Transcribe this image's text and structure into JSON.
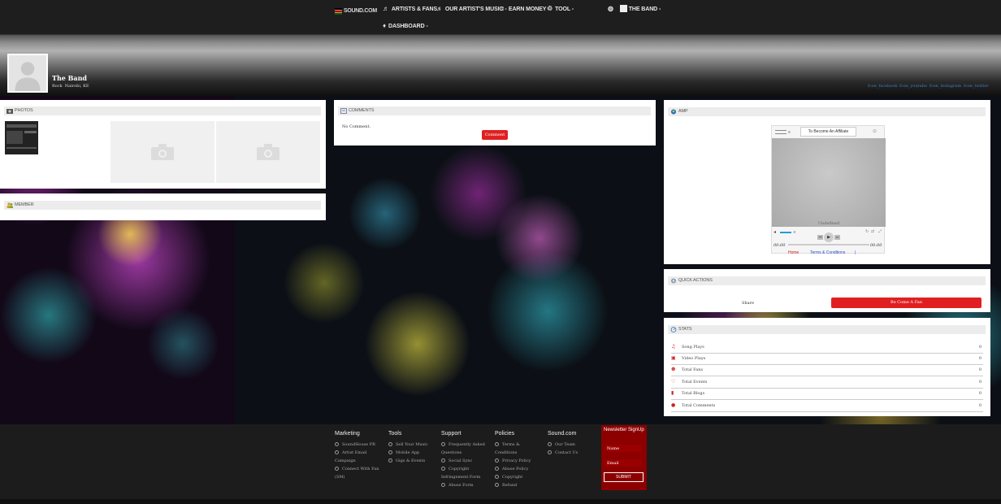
{
  "topnav": {
    "logo_text": "SOUND.COM",
    "items": [
      {
        "label": "ARTISTS & FANS",
        "icon": "music-note-icon"
      },
      {
        "label": "OUR ARTIST'S MUSIC",
        "icon": "music-note-icon"
      },
      {
        "label": "EARN MONEY",
        "icon": "music-note-icon"
      },
      {
        "label": "TOOL",
        "icon": "settings-icon"
      },
      {
        "label": "THE BAND",
        "icon": "globe-icon"
      },
      {
        "label": "DASHBOARD",
        "icon": "diamond-icon"
      }
    ],
    "caret": "-"
  },
  "profile": {
    "name": "The Band",
    "genre": "Rock",
    "location": "Nairobi, KE",
    "social_links": [
      "fcon_facebook",
      "fcon_youtube",
      "fcon_instagram",
      "fcon_twitter"
    ]
  },
  "photos": {
    "title": "PHOTOS"
  },
  "member": {
    "title": "MEMBER"
  },
  "comments": {
    "title": "COMMENTS",
    "empty_text": "No Comment.",
    "button_label": "Comment"
  },
  "amp": {
    "title": "AMP",
    "affiliate_label": "To Become An Affiliate",
    "track_status": "Undefined",
    "time_current": "00:00",
    "time_total": "00:00",
    "link_home": "Home",
    "link_terms": "Terms & Conditions",
    "link_sep": "|"
  },
  "quick_actions": {
    "title": "QUICK ACTIONS",
    "share_label": "Share",
    "fan_button": "Be Come A Fan"
  },
  "stats": {
    "title": "STATS",
    "rows": [
      {
        "label": "Song Plays",
        "value": "0",
        "icon": "music-note-icon"
      },
      {
        "label": "Video Plays",
        "value": "0",
        "icon": "video-icon"
      },
      {
        "label": "Total Fans",
        "value": "0",
        "icon": "users-icon"
      },
      {
        "label": "Total Events",
        "value": "0",
        "icon": "calendar-icon"
      },
      {
        "label": "Total Blogs",
        "value": "0",
        "icon": "bookmark-icon"
      },
      {
        "label": "Total Comments",
        "value": "0",
        "icon": "comments-icon"
      }
    ]
  },
  "footer": {
    "columns": [
      {
        "title": "Marketing",
        "links": [
          "SoundHouse PR",
          "Artist Email Campaign",
          "Connect With Fan (SM)"
        ]
      },
      {
        "title": "Tools",
        "links": [
          "Sell Your Music",
          "Mobile App",
          "Gigs & Events"
        ]
      },
      {
        "title": "Support",
        "links": [
          "Frequently Asked Questions",
          "Social Sync",
          "Copyright Infringement Form",
          "Abuse Form"
        ]
      },
      {
        "title": "Policies",
        "links": [
          "Terms & Conditions",
          "Privacy Policy",
          "Abuse Policy",
          "Copyright",
          "Refund"
        ]
      },
      {
        "title": "Sound.com",
        "links": [
          "Our Team",
          "Contact Us"
        ]
      }
    ],
    "newsletter": {
      "title": "Newsletter SignUp",
      "name_placeholder": "Name",
      "email_placeholder": "Email",
      "submit_label": "SUBMIT"
    }
  },
  "colors": {
    "accent_red": "#e02020",
    "newsletter_red": "#8c0000",
    "link_blue": "#3a7fc6"
  }
}
